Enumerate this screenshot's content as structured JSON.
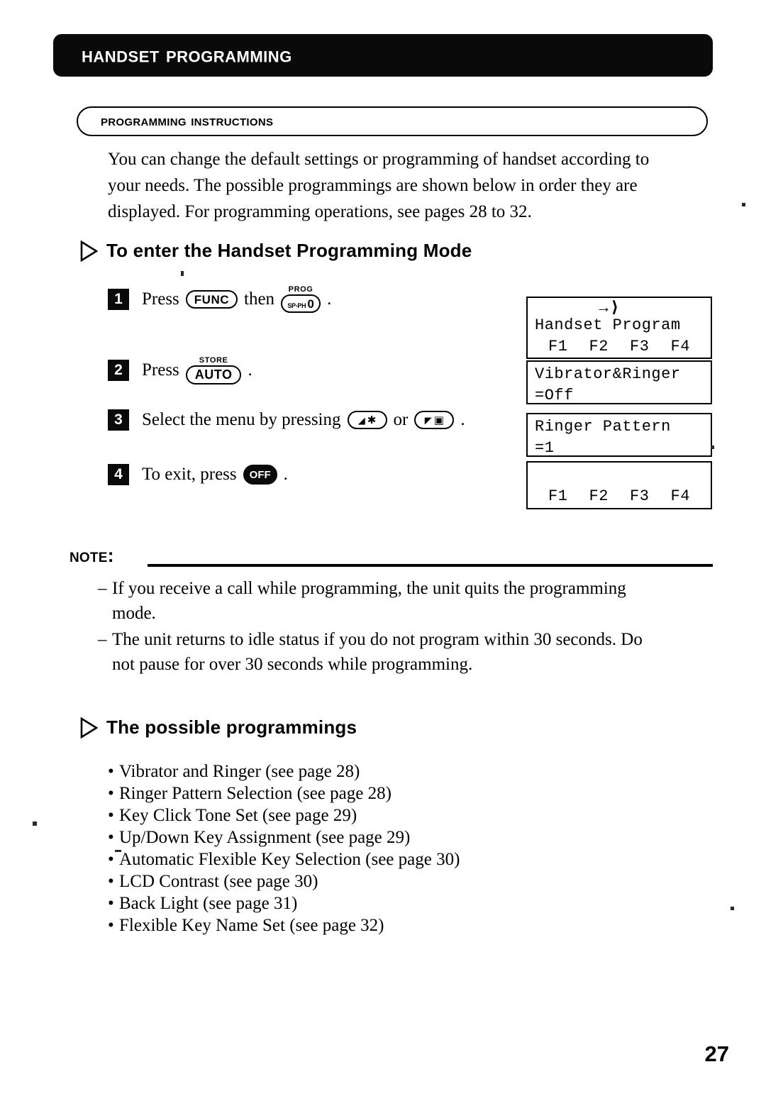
{
  "header": {
    "title": "Handset Programming"
  },
  "section": {
    "label": "Programming Instructions"
  },
  "intro": {
    "line1": "You can change the default settings or programming of handset according to",
    "line2": "your needs. The possible programmings are shown below in order they are",
    "line3": "displayed. For programming operations, see pages 28 to 32."
  },
  "headings": {
    "enter_mode": "To enter the Handset Programming Mode",
    "possible": "The possible programmings",
    "triangle_icon": "triangle-right-outline-icon"
  },
  "steps": [
    {
      "number": "1",
      "text_before": "Press",
      "key1_label": "FUNC",
      "text_middle": "then",
      "key2_cap": "PROG",
      "key2_small": "SP-PH",
      "key2_big": "0",
      "text_after": "."
    },
    {
      "number": "2",
      "text_before": "Press",
      "key1_cap": "STORE",
      "key1_label": "AUTO",
      "text_after": "."
    },
    {
      "number": "3",
      "text_before": "Select the menu by pressing",
      "key1_sym1": "◢",
      "key1_sym2": "✱",
      "text_middle": "or",
      "key2_sym1": "◤",
      "key2_sym2": "▣",
      "text_after": "."
    },
    {
      "number": "4",
      "text_before": "To exit, press",
      "key1_label": "OFF",
      "text_after": "."
    }
  ],
  "lcd_screens": [
    {
      "name": "handset-program",
      "arrow": "→⟩",
      "line1": "Handset Program",
      "fkeys": [
        "F1",
        "F2",
        "F3",
        "F4"
      ]
    },
    {
      "name": "vibrator-ringer",
      "line1": "Vibrator&Ringer",
      "line2": "=Off"
    },
    {
      "name": "ringer-pattern",
      "line1": "Ringer Pattern",
      "line2": "=1"
    },
    {
      "name": "function-keys",
      "line1": "",
      "fkeys": [
        "F1",
        "F2",
        "F3",
        "F4"
      ]
    }
  ],
  "note": {
    "label": "Note:",
    "dash": "–",
    "items": [
      {
        "line1": "If you receive a call while programming, the unit quits the programming",
        "line2": "mode."
      },
      {
        "line1": "The unit returns to idle status if you do not program within 30 seconds. Do",
        "line2": "not pause for over 30 seconds while programming."
      }
    ]
  },
  "bullets": {
    "dot": "•",
    "items": [
      "Vibrator and Ringer (see page 28)",
      "Ringer Pattern Selection (see page 28)",
      "Key Click Tone Set (see page 29)",
      "Up/Down Key Assignment (see page 29)",
      "Automatic Flexible Key Selection (see page 30)",
      "LCD Contrast (see page 30)",
      "Back Light (see page 31)",
      "Flexible Key Name Set (see page 32)"
    ]
  },
  "page_number": "27",
  "colors": {
    "ink": "#000000",
    "paper": "#ffffff",
    "header_bg": "#0a0a0a"
  }
}
